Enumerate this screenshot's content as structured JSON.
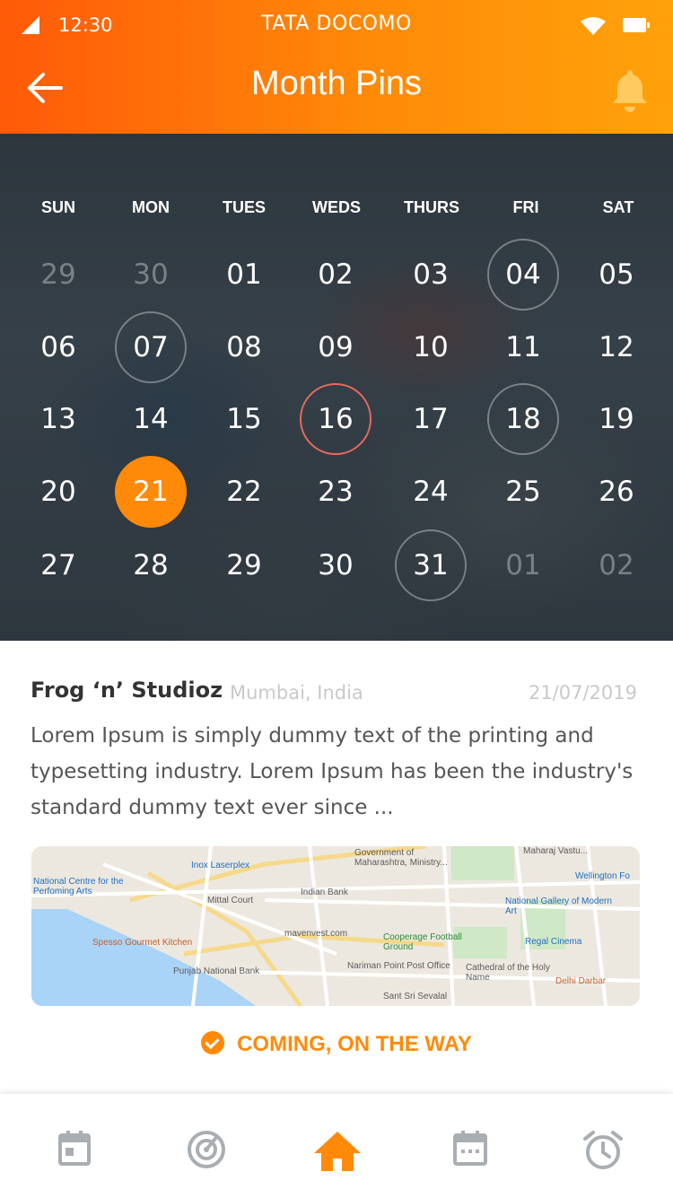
{
  "status_bar": {
    "time": "12:30",
    "carrier": "TATA DOCOMO"
  },
  "header": {
    "title": "Month Pins"
  },
  "calendar": {
    "weekdays": [
      "SUN",
      "MON",
      "TUES",
      "WEDS",
      "THURS",
      "FRI",
      "SAT"
    ],
    "weeks": [
      [
        "29",
        "30",
        "01",
        "02",
        "03",
        "04",
        "05"
      ],
      [
        "06",
        "07",
        "08",
        "09",
        "10",
        "11",
        "12"
      ],
      [
        "13",
        "14",
        "15",
        "16",
        "17",
        "18",
        "19"
      ],
      [
        "20",
        "21",
        "22",
        "23",
        "24",
        "25",
        "26"
      ],
      [
        "27",
        "28",
        "29",
        "30",
        "31",
        "01",
        "02"
      ]
    ],
    "selected": "21",
    "accent": "#ff8a0a"
  },
  "event": {
    "name": "Frog ‘n’ Studioz",
    "location": "Mumbai, India",
    "date": "21/07/2019",
    "description": "Lorem Ipsum is simply dummy text of the printing and typesetting industry. Lorem Ipsum has been the industry's standard dummy text ever since ...",
    "status": "COMING, ON THE WAY",
    "map_labels": [
      "Government of Maharashtra, Ministry...",
      "Inox Laserplex",
      "Maharaj Vastu...",
      "Wellington Fo",
      "National Centre for the Perfoming Arts",
      "Mittal Court",
      "Indian Bank",
      "National Gallery of Modern Art",
      "Regal Cinema",
      "mavenvest.com",
      "Spesso Gourmet Kitchen",
      "Cooperage Football Ground",
      "Punjab National Bank",
      "Nariman Point Post Office",
      "Cathedral of the Holy Name",
      "Delhi Darbar",
      "Sant Sri Sevalal"
    ]
  },
  "bottom_nav": {
    "items": [
      {
        "icon": "calendar-icon"
      },
      {
        "icon": "radar-icon"
      },
      {
        "icon": "home-icon",
        "active": true
      },
      {
        "icon": "calendar-dots-icon"
      },
      {
        "icon": "alarm-icon"
      }
    ],
    "active_color": "#ff8a0a",
    "inactive_color": "#a9aeb3"
  }
}
